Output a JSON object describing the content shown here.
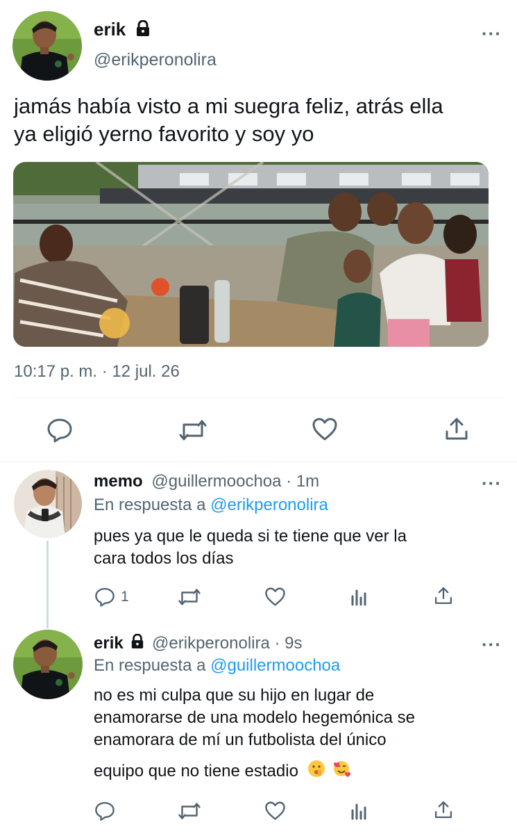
{
  "main_tweet": {
    "display_name": "erik",
    "handle": "@erikperonolira",
    "text_line1": "jamás había visto a mi suegra feliz, atrás ella",
    "text_line2": "ya eligió yerno favorito y soy yo",
    "time": "10:17 p. m.",
    "separator": "·",
    "date": "12 jul. 26"
  },
  "reply1": {
    "display_name": "memo",
    "handle": "@guillermoochoa",
    "time": "· 1m",
    "in_reply_prefix": "En respuesta a",
    "in_reply_handle": "@erikperonolira",
    "text_line1": "pues ya que le queda si te tiene que ver la",
    "text_line2": "cara todos los días",
    "reply_count": "1"
  },
  "reply2": {
    "display_name": "erik",
    "handle": "@erikperonolira",
    "time": "· 9s",
    "in_reply_prefix": "En respuesta a",
    "in_reply_handle": "@guillermoochoa",
    "text_line1": "no es mi culpa que su hijo en lugar de",
    "text_line2": "enamorarse de una modelo hegemónica se",
    "text_line3": "enamorara de mí un futbolista del único",
    "text_line4": "equipo que no tiene estadio"
  },
  "icons": {
    "more": "more-icon",
    "lock": "lock-icon",
    "reply": "reply-icon",
    "retweet": "retweet-icon",
    "like": "like-icon",
    "share": "share-icon",
    "views": "views-icon"
  },
  "colors": {
    "link": "#1d9bf0",
    "muted": "#536471",
    "text": "#0f1419"
  }
}
